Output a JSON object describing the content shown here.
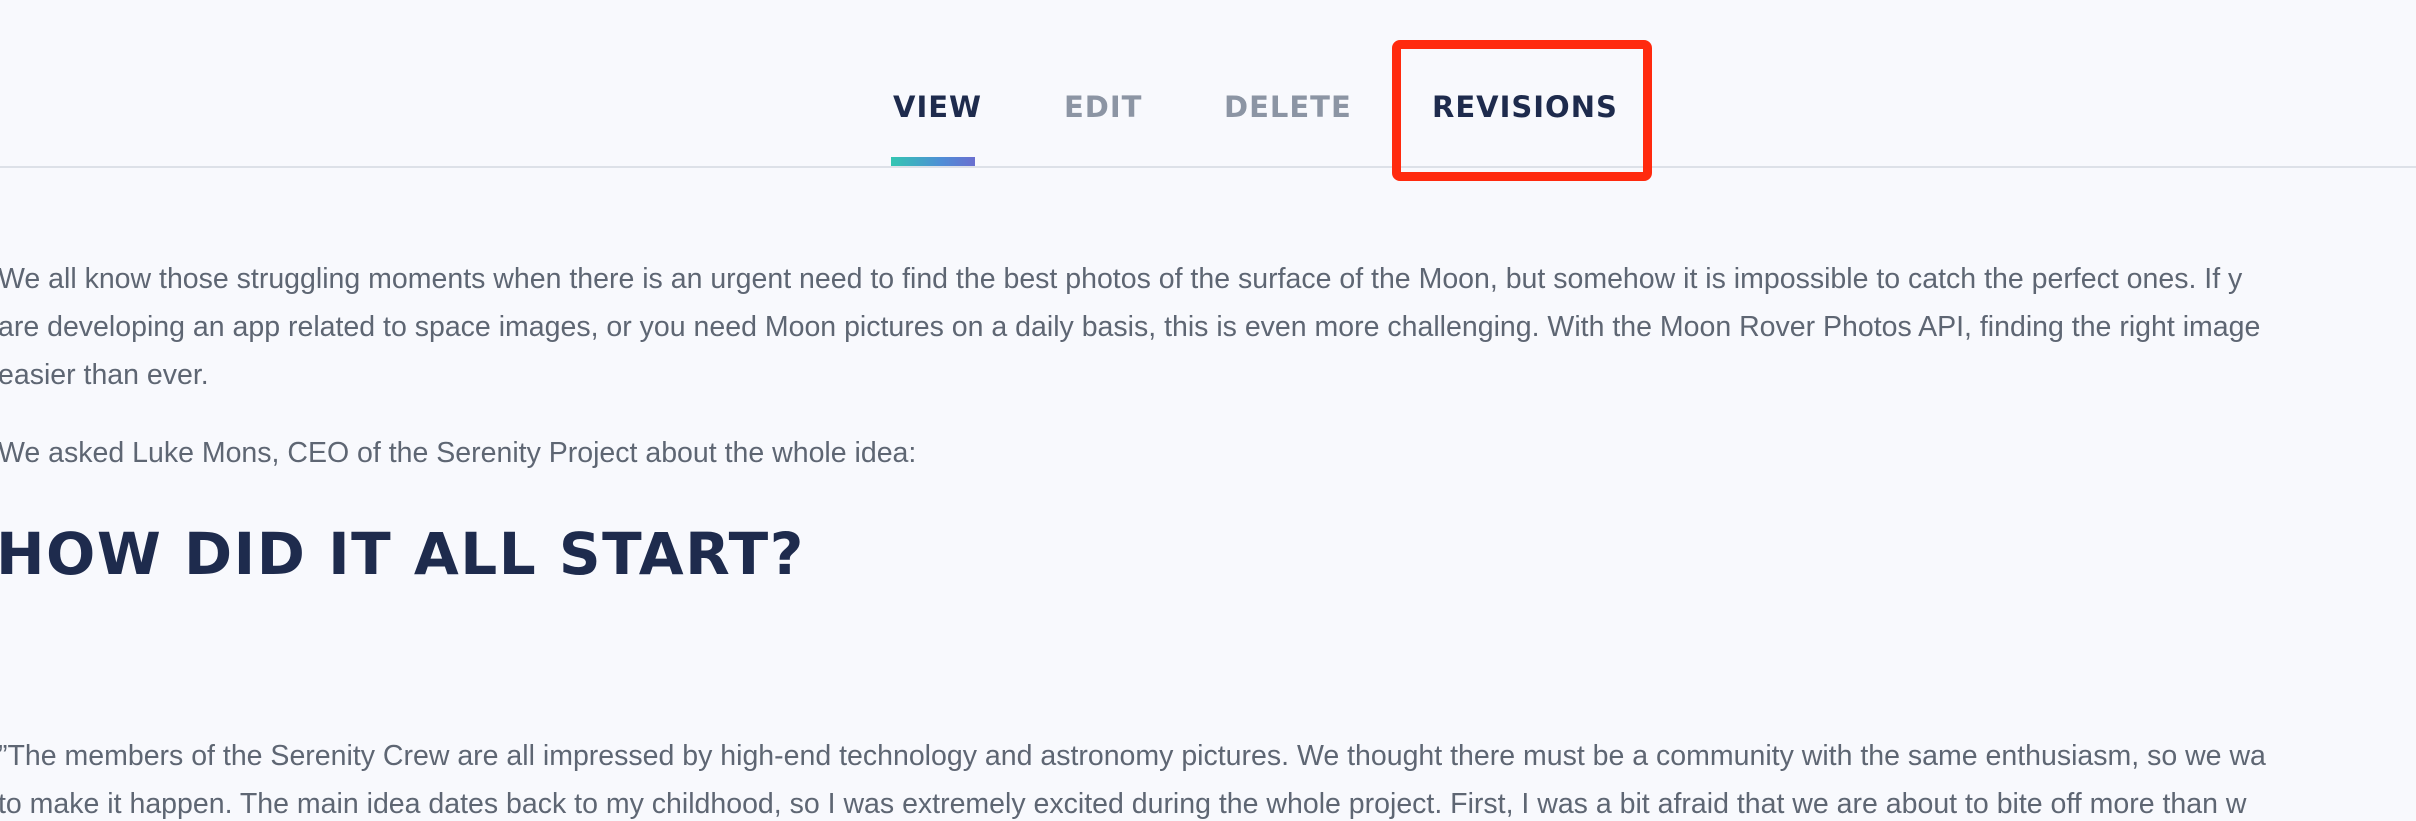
{
  "tabs": {
    "view": "VIEW",
    "edit": "EDIT",
    "delete": "DELETE",
    "revisions": "REVISIONS",
    "active": "view",
    "highlighted": "revisions"
  },
  "article": {
    "intro_lines": [
      "We all know those struggling moments when there is an urgent need to find the best photos of  the surface of the Moon, but somehow it is impossible to catch the perfect ones. If y",
      "are developing an app related to space images, or you need Moon pictures on a daily basis, this is even more challenging. With the Moon Rover Photos API, finding the right image",
      "easier than ever."
    ],
    "question": "We asked Luke Mons, CEO of the Serenity Project about the whole idea:",
    "heading": "HOW DID IT ALL START?",
    "quote_lines": [
      "”The members of the Serenity Crew are all impressed by high-end technology and astronomy pictures. We thought there must be a community with the same enthusiasm, so we wa",
      "to make it happen. The main idea dates back to my childhood, so I was extremely excited during the whole project. First, I was a bit afraid that we are about to bite off more than w"
    ]
  },
  "colors": {
    "background": "#f8f9fd",
    "active_tab": "#1e2b4d",
    "inactive_tab": "#8c95a4",
    "highlight": "#ff2a0e",
    "body_text": "#5e6673"
  }
}
